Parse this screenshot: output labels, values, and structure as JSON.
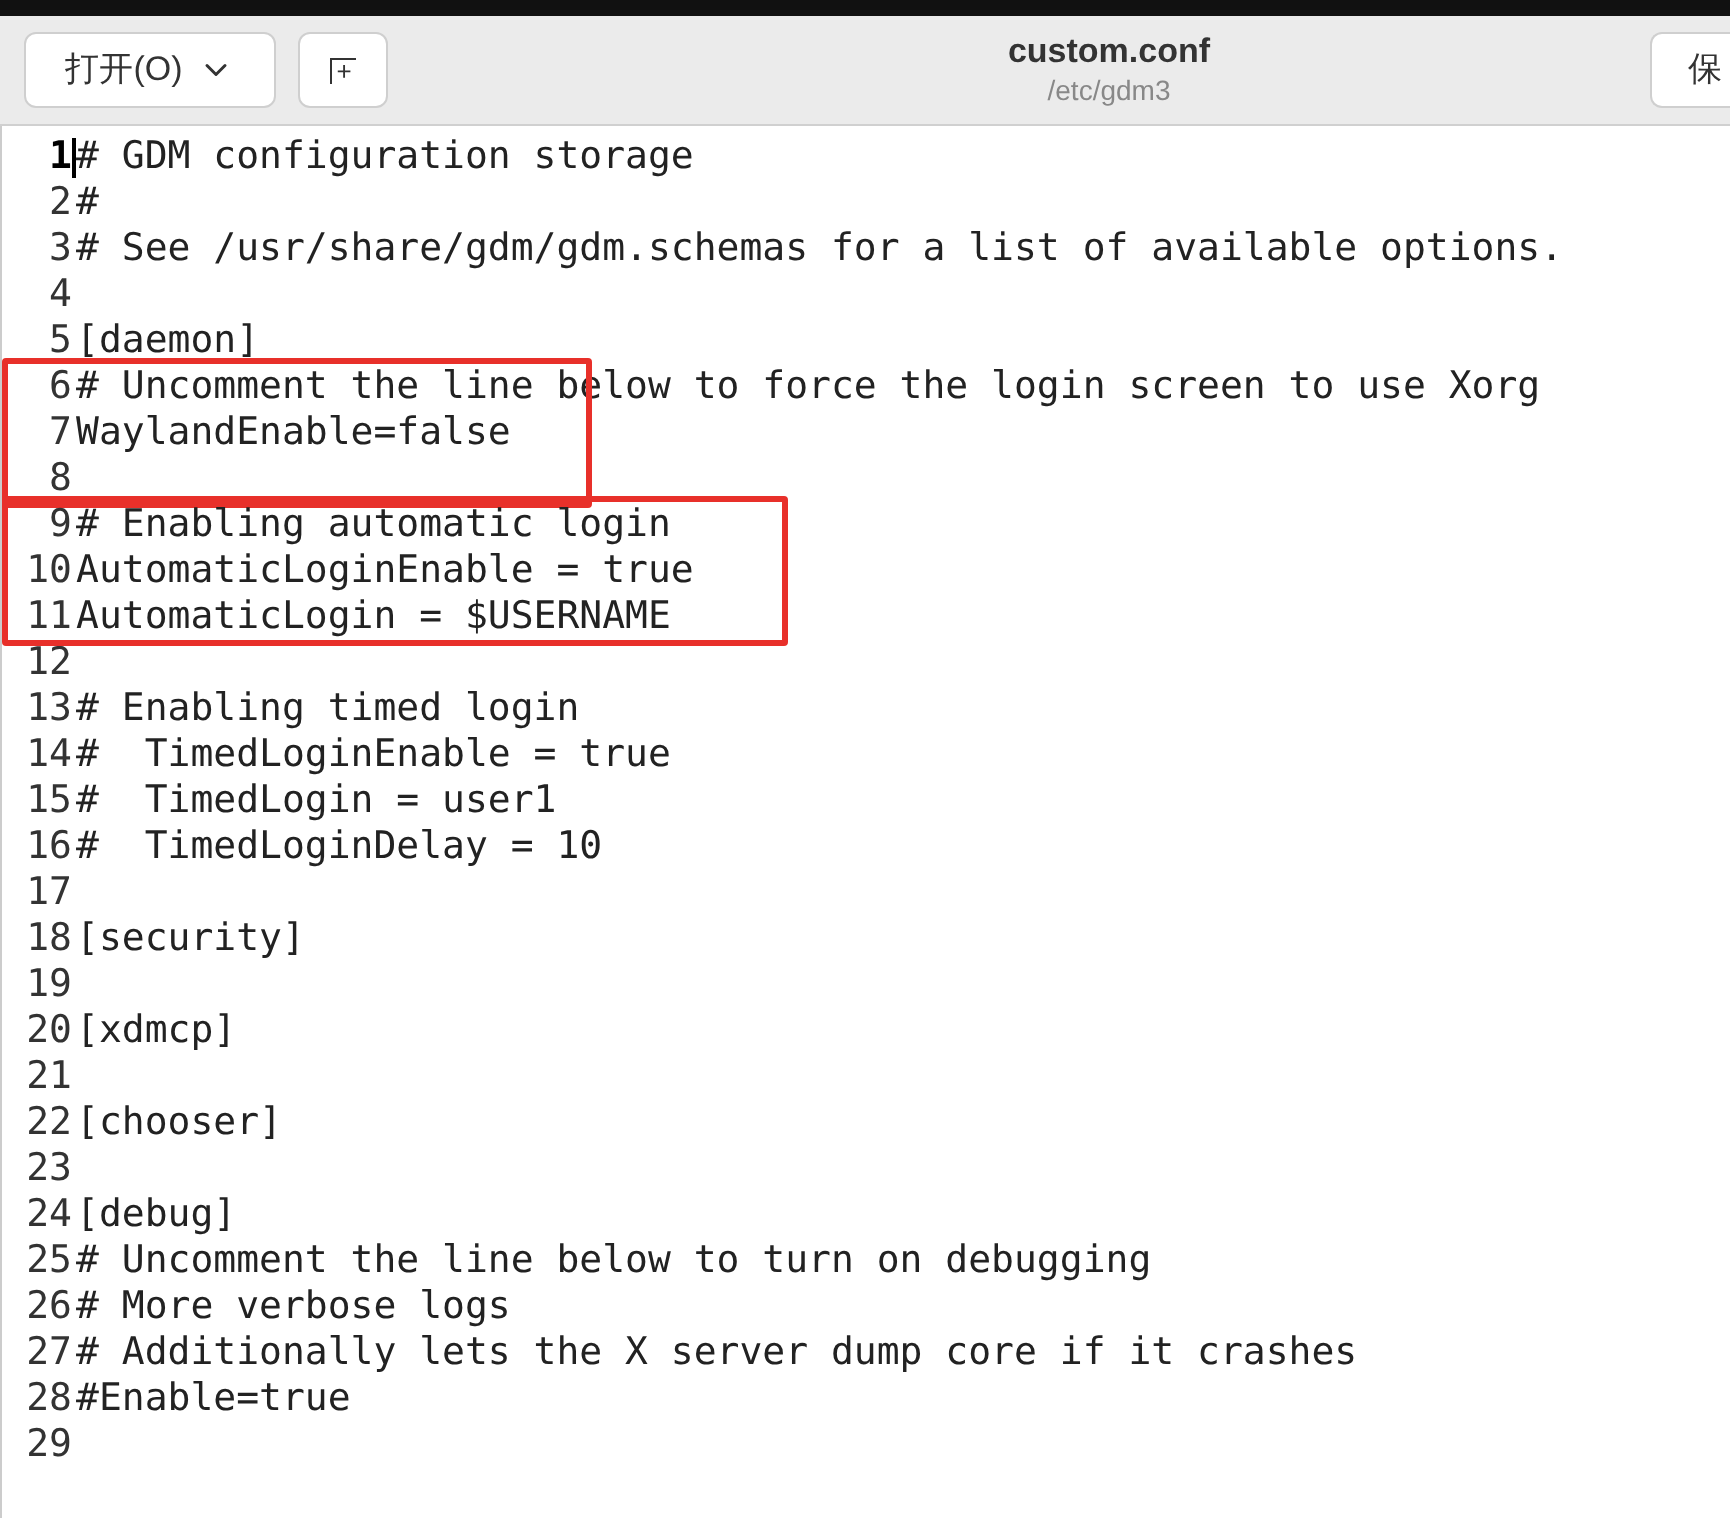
{
  "header": {
    "open_button": "打开(O)",
    "new_tab_button": "+",
    "title": "custom.conf",
    "subtitle": "/etc/gdm3",
    "save_button": "保"
  },
  "editor": {
    "items": [
      {
        "kind": "line",
        "number": "1",
        "text": "# GDM configuration storage",
        "current": true
      },
      {
        "kind": "line",
        "number": "2",
        "text": "#",
        "current": false
      },
      {
        "kind": "line",
        "number": "3",
        "text": "# See /usr/share/gdm/gdm.schemas for a list of available options.",
        "current": false
      },
      {
        "kind": "line",
        "number": "4",
        "current": false
      },
      {
        "kind": "line",
        "number": "5",
        "text": "[daemon]",
        "current": false
      },
      {
        "kind": "box",
        "lines": [
          {
            "kind": "line",
            "number": "6",
            "text": "# Uncomment the line below to force the login screen to use Xorg",
            "current": false
          },
          {
            "kind": "line",
            "number": "7",
            "text": "WaylandEnable=false",
            "current": false
          },
          {
            "kind": "line",
            "number": "8",
            "current": false
          }
        ]
      },
      {
        "kind": "box",
        "lines": [
          {
            "kind": "line",
            "number": "9",
            "text": "# Enabling automatic login",
            "current": false
          },
          {
            "kind": "line",
            "number": "10",
            "text": "AutomaticLoginEnable = true",
            "current": false
          },
          {
            "kind": "line",
            "number": "11",
            "text": "AutomaticLogin = $USERNAME",
            "current": false
          }
        ]
      },
      {
        "kind": "line",
        "number": "12",
        "current": false
      },
      {
        "kind": "line",
        "number": "13",
        "text": "# Enabling timed login",
        "current": false
      },
      {
        "kind": "line",
        "number": "14",
        "text": "#  TimedLoginEnable = true",
        "current": false
      },
      {
        "kind": "line",
        "number": "15",
        "text": "#  TimedLogin = user1",
        "current": false
      },
      {
        "kind": "line",
        "number": "16",
        "text": "#  TimedLoginDelay = 10",
        "current": false
      },
      {
        "kind": "line",
        "number": "17",
        "current": false
      },
      {
        "kind": "line",
        "number": "18",
        "text": "[security]",
        "current": false
      },
      {
        "kind": "line",
        "number": "19",
        "current": false
      },
      {
        "kind": "line",
        "number": "20",
        "text": "[xdmcp]",
        "current": false
      },
      {
        "kind": "line",
        "number": "21",
        "current": false
      },
      {
        "kind": "line",
        "number": "22",
        "text": "[chooser]",
        "current": false
      },
      {
        "kind": "line",
        "number": "23",
        "current": false
      },
      {
        "kind": "line",
        "number": "24",
        "text": "[debug]",
        "current": false
      },
      {
        "kind": "line",
        "number": "25",
        "text": "# Uncomment the line below to turn on debugging",
        "current": false
      },
      {
        "kind": "line",
        "number": "26",
        "text": "# More verbose logs",
        "current": false
      },
      {
        "kind": "line",
        "number": "27",
        "text": "# Additionally lets the X server dump core if it crashes",
        "current": false
      },
      {
        "kind": "line",
        "number": "28",
        "text": "#Enable=true",
        "current": false
      },
      {
        "kind": "line",
        "number": "29",
        "current": false
      }
    ]
  }
}
